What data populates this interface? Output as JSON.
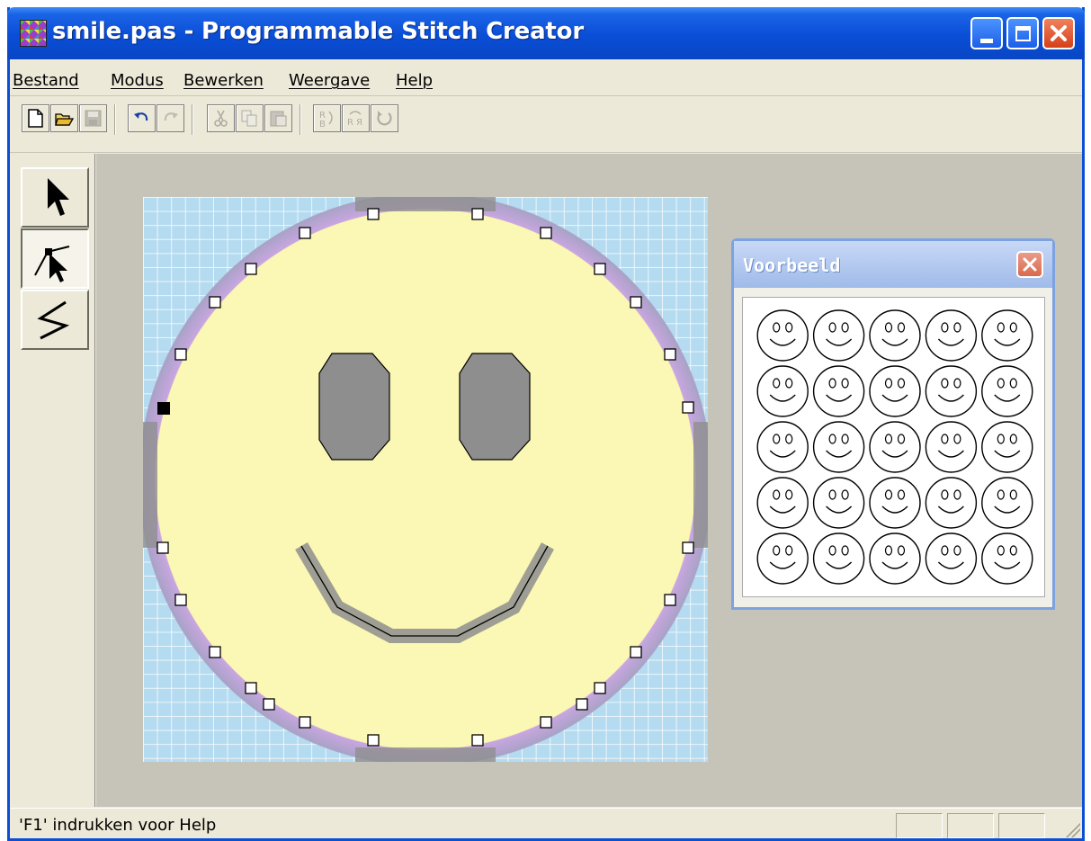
{
  "window": {
    "title": "smile.pas - Programmable Stitch Creator",
    "app_icon": "colorful-patch-icon",
    "controls": [
      "minimize",
      "maximize",
      "close"
    ]
  },
  "menu": {
    "items": [
      "Bestand",
      "Modus",
      "Bewerken",
      "Weergave",
      "Help"
    ]
  },
  "toolbar": {
    "buttons": [
      {
        "icon": "new-file-icon",
        "enabled": true
      },
      {
        "icon": "open-folder-icon",
        "enabled": true
      },
      {
        "icon": "save-icon",
        "enabled": false
      },
      {
        "icon": "undo-icon",
        "enabled": true
      },
      {
        "icon": "redo-icon",
        "enabled": false
      },
      {
        "icon": "cut-icon",
        "enabled": false
      },
      {
        "icon": "copy-icon",
        "enabled": false
      },
      {
        "icon": "paste-icon",
        "enabled": false
      },
      {
        "icon": "mirror-icon",
        "enabled": false
      },
      {
        "icon": "mirror-both-icon",
        "enabled": false
      },
      {
        "icon": "rotate-icon",
        "enabled": false
      }
    ]
  },
  "tools": [
    {
      "name": "select-tool",
      "icon": "arrow-pointer-icon",
      "active": false
    },
    {
      "name": "node-tool",
      "icon": "node-pointer-icon",
      "active": true
    },
    {
      "name": "stitch-tool",
      "icon": "zigzag-icon",
      "active": false
    }
  ],
  "preview": {
    "title": "Voorbeeld",
    "rows": 5,
    "cols": 5,
    "glyph": "smiley-icon"
  },
  "statusbar": {
    "text": "'F1' indrukken voor Help"
  },
  "colors": {
    "titlebar": "#0a4ed7",
    "face_fill": "#fbf7b4",
    "outline": "#a9a2c6",
    "stitch": "#8e8e8e",
    "background_fabric": "#b5dbf0"
  }
}
